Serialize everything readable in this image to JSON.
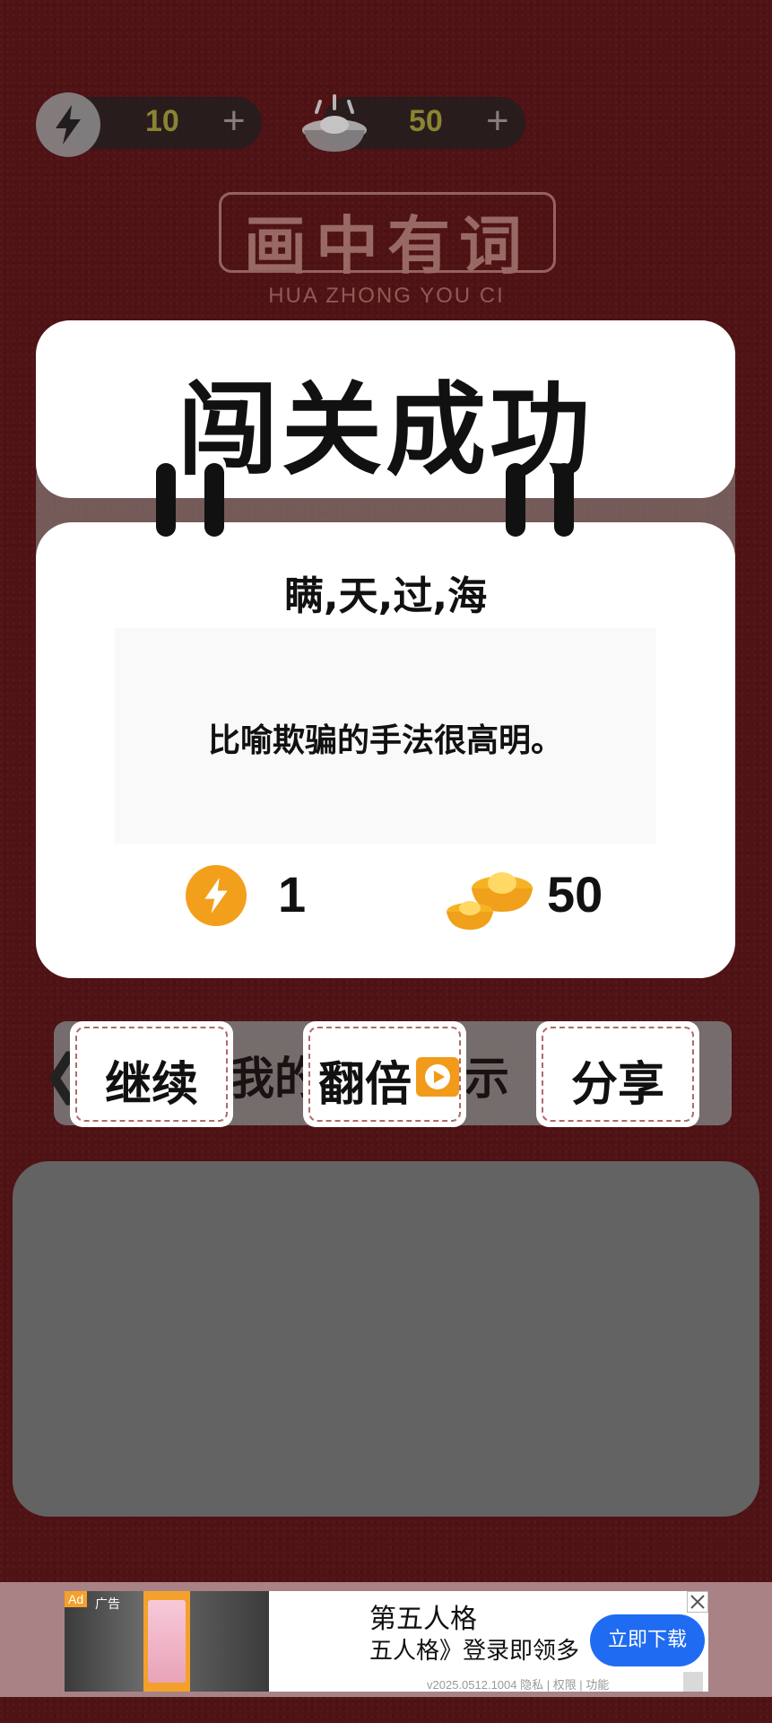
{
  "hud": {
    "energy": {
      "icon": "lightning-icon",
      "value": "10",
      "plus": "+"
    },
    "ingots": {
      "icon": "gold-ingot-icon",
      "value": "50",
      "plus": "+"
    }
  },
  "game_title": {
    "text": "画中有词",
    "pinyin": "HUA ZHONG YOU CI"
  },
  "result": {
    "banner": "闯关成功",
    "idiom": "瞒,天,过,海",
    "meaning": "比喻欺骗的手法很高明。",
    "rewards": {
      "energy": {
        "icon": "lightning-icon",
        "value": "1"
      },
      "ingots": {
        "icon": "gold-ingot-icon",
        "value": "50"
      }
    }
  },
  "actions": {
    "continue": "继续",
    "double": "翻倍",
    "share": "分享",
    "behind_left": "我的",
    "behind_right": "示"
  },
  "ad": {
    "tag": "Ad",
    "tag_label": "广告",
    "title": "第五人格",
    "description": "五人格》登录即领多",
    "cta": "立即下载",
    "meta": "v2025.0512.1004  隐私 | 权限 | 功能"
  },
  "colors": {
    "background": "#5a1518",
    "accent_orange": "#f2a01c",
    "ad_button": "#1f6cf2"
  }
}
